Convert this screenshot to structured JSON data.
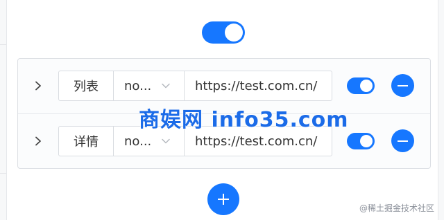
{
  "master_toggle": {
    "on": true
  },
  "rules": [
    {
      "type": "列表",
      "method": "no...",
      "url": "https://test.com.cn/",
      "enabled": true
    },
    {
      "type": "详情",
      "method": "no...",
      "url": "https://test.com.cn/",
      "enabled": true
    }
  ],
  "watermark": "商娱网 info35.com",
  "credit": "@稀土掘金技术社区",
  "colors": {
    "accent": "#1677ff",
    "border": "#d9dce1"
  },
  "icons": {
    "expand": "chevron-right-icon",
    "dropdown": "chevron-down-icon",
    "remove": "minus-icon",
    "add": "plus-icon"
  }
}
